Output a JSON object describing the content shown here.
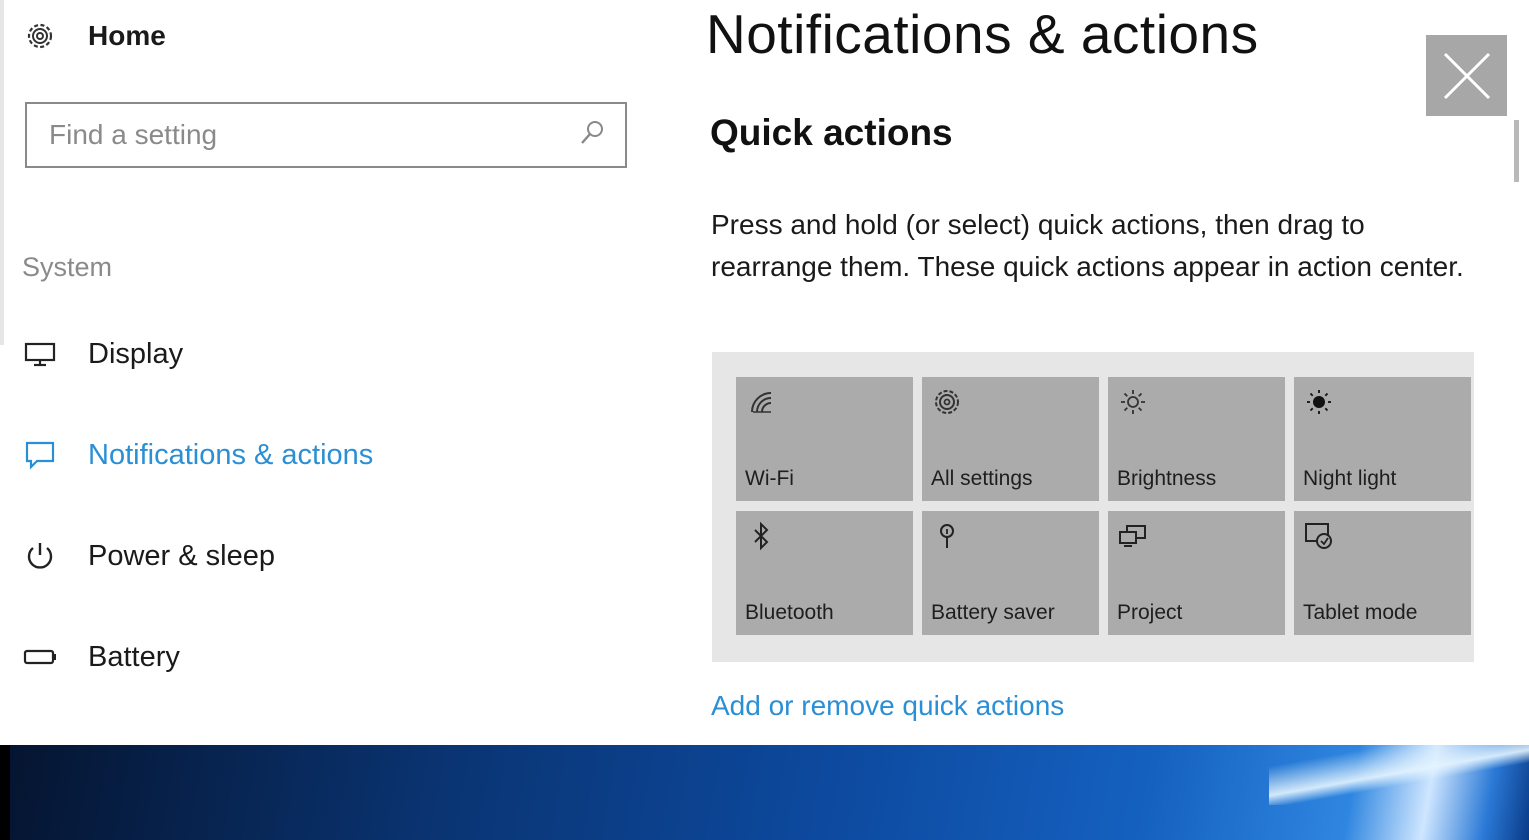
{
  "sidebar": {
    "home_label": "Home",
    "search": {
      "placeholder": "Find a setting"
    },
    "section_label": "System",
    "items": [
      {
        "label": "Display",
        "icon": "monitor-icon"
      },
      {
        "label": "Notifications & actions",
        "icon": "message-icon",
        "active": true
      },
      {
        "label": "Power & sleep",
        "icon": "power-icon"
      },
      {
        "label": "Battery",
        "icon": "battery-icon"
      }
    ]
  },
  "main": {
    "title": "Notifications & actions",
    "section_title": "Quick actions",
    "description": "Press and hold (or select) quick actions, then drag to rearrange them. These quick actions appear in action center.",
    "quick_actions": [
      {
        "label": "Wi-Fi",
        "icon": "wifi-icon"
      },
      {
        "label": "All settings",
        "icon": "gear-icon"
      },
      {
        "label": "Brightness",
        "icon": "sun-icon"
      },
      {
        "label": "Night light",
        "icon": "night-light-icon"
      },
      {
        "label": "Bluetooth",
        "icon": "bluetooth-icon"
      },
      {
        "label": "Battery saver",
        "icon": "battery-saver-icon"
      },
      {
        "label": "Project",
        "icon": "project-icon"
      },
      {
        "label": "Tablet mode",
        "icon": "tablet-mode-icon"
      }
    ],
    "link_label": "Add or remove quick actions"
  },
  "colors": {
    "accent": "#2b8fd6",
    "tile": "#ababab",
    "panel": "#e6e6e6"
  }
}
